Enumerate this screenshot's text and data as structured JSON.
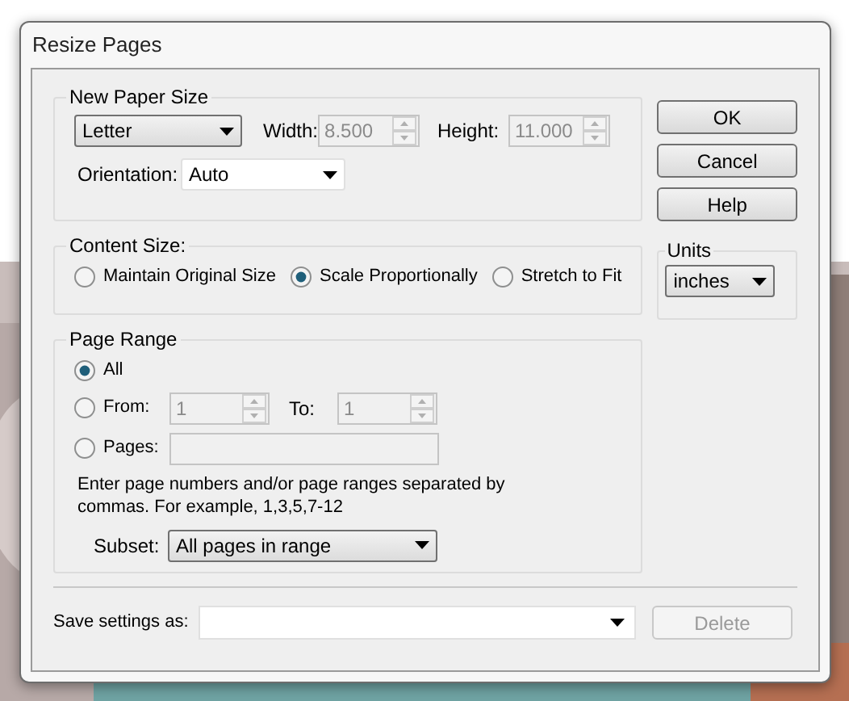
{
  "window": {
    "title": "Resize Pages"
  },
  "new_paper_size": {
    "title": "New Paper Size",
    "paper": "Letter",
    "width": {
      "label": "Width:",
      "value": "8.500",
      "disabled": true
    },
    "height": {
      "label": "Height:",
      "value": "11.000",
      "disabled": true
    },
    "orientation": {
      "label": "Orientation:",
      "value": "Auto"
    }
  },
  "content_size": {
    "title": "Content Size:",
    "options": [
      {
        "label": "Maintain Original Size",
        "selected": false
      },
      {
        "label": "Scale Proportionally",
        "selected": true
      },
      {
        "label": "Stretch to Fit",
        "selected": false
      }
    ]
  },
  "units": {
    "title": "Units",
    "value": "inches"
  },
  "page_range": {
    "title": "Page Range",
    "options": [
      {
        "kind": "all",
        "label": "All",
        "selected": true
      },
      {
        "kind": "from",
        "label": "From:",
        "selected": false
      },
      {
        "kind": "pages",
        "label": "Pages:",
        "selected": false
      }
    ],
    "from": {
      "value": "1",
      "disabled": true
    },
    "to": {
      "label": "To:",
      "value": "1",
      "disabled": true
    },
    "pages_field": {
      "disabled": true
    },
    "hint": "Enter page numbers and/or page ranges separated by commas. For example, 1,3,5,7-12",
    "subset": {
      "label": "Subset:",
      "value": "All pages in range"
    }
  },
  "save_settings": {
    "label": "Save settings as:"
  },
  "buttons": [
    {
      "label": "OK",
      "disabled": false
    },
    {
      "label": "Cancel",
      "disabled": false
    },
    {
      "label": "Help",
      "disabled": false
    }
  ],
  "delete_button": {
    "label": "Delete",
    "disabled": true
  }
}
